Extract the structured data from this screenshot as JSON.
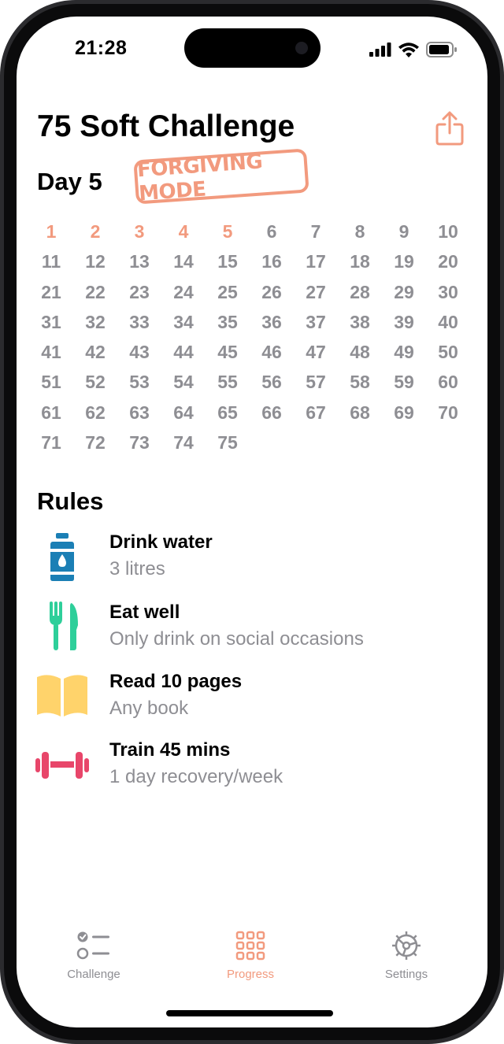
{
  "status_bar": {
    "time": "21:28"
  },
  "header": {
    "title": "75 Soft Challenge",
    "day_label": "Day 5",
    "mode_stamp": "FORGIVING MODE"
  },
  "progress": {
    "completed_days": 5,
    "days": [
      "1",
      "2",
      "3",
      "4",
      "5",
      "6",
      "7",
      "8",
      "9",
      "10",
      "11",
      "12",
      "13",
      "14",
      "15",
      "16",
      "17",
      "18",
      "19",
      "20",
      "21",
      "22",
      "23",
      "24",
      "25",
      "26",
      "27",
      "28",
      "29",
      "30",
      "31",
      "32",
      "33",
      "34",
      "35",
      "36",
      "37",
      "38",
      "39",
      "40",
      "41",
      "42",
      "43",
      "44",
      "45",
      "46",
      "47",
      "48",
      "49",
      "50",
      "51",
      "52",
      "53",
      "54",
      "55",
      "56",
      "57",
      "58",
      "59",
      "60",
      "61",
      "62",
      "63",
      "64",
      "65",
      "66",
      "67",
      "68",
      "69",
      "70",
      "71",
      "72",
      "73",
      "74",
      "75"
    ]
  },
  "rules": {
    "title": "Rules",
    "items": [
      {
        "icon": "water-bottle-icon",
        "title": "Drink water",
        "subtitle": "3 litres",
        "color": "#1b7fb5"
      },
      {
        "icon": "fork-knife-icon",
        "title": "Eat well",
        "subtitle": "Only drink on social occasions",
        "color": "#2ecf9a"
      },
      {
        "icon": "book-icon",
        "title": "Read 10 pages",
        "subtitle": "Any book",
        "color": "#ffd36b"
      },
      {
        "icon": "dumbbell-icon",
        "title": "Train 45 mins",
        "subtitle": "1 day recovery/week",
        "color": "#e8466a"
      }
    ]
  },
  "tabbar": {
    "tabs": [
      {
        "label": "Challenge",
        "icon": "checklist-icon",
        "active": false
      },
      {
        "label": "Progress",
        "icon": "grid-icon",
        "active": true
      },
      {
        "label": "Settings",
        "icon": "gear-icon",
        "active": false
      }
    ]
  },
  "colors": {
    "accent": "#f29a7e",
    "muted": "#8e8e93"
  }
}
